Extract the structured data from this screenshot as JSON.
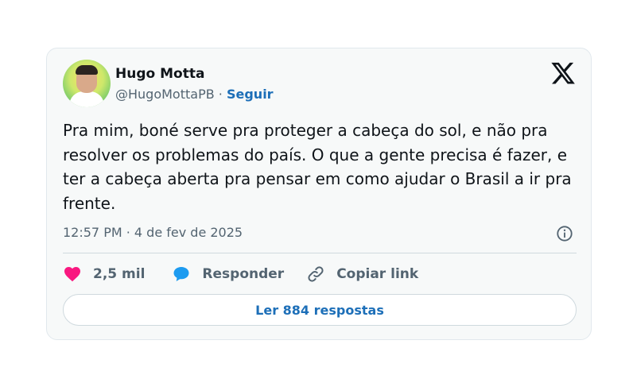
{
  "author": {
    "name": "Hugo Motta",
    "handle": "@HugoMottaPB",
    "separator": "·",
    "follow_label": "Seguir"
  },
  "tweet": {
    "text": "Pra mim, boné serve pra proteger a cabeça do sol, e não pra resolver os problemas do país. O que a gente precisa é fazer, e ter a cabeça aberta pra pensar em como ajudar o Brasil a ir pra frente.",
    "timestamp": "12:57 PM · 4 de fev de 2025"
  },
  "actions": {
    "likes": "2,5 mil",
    "reply_label": "Responder",
    "copy_label": "Copiar link"
  },
  "read_replies_label": "Ler 884 respostas",
  "colors": {
    "heart": "#f91880",
    "reply_bubble": "#1d9bf0",
    "link_blue": "#1d6fb8"
  },
  "icons": [
    "x-logo-icon",
    "info-icon",
    "heart-icon",
    "reply-bubble-icon",
    "link-icon"
  ]
}
